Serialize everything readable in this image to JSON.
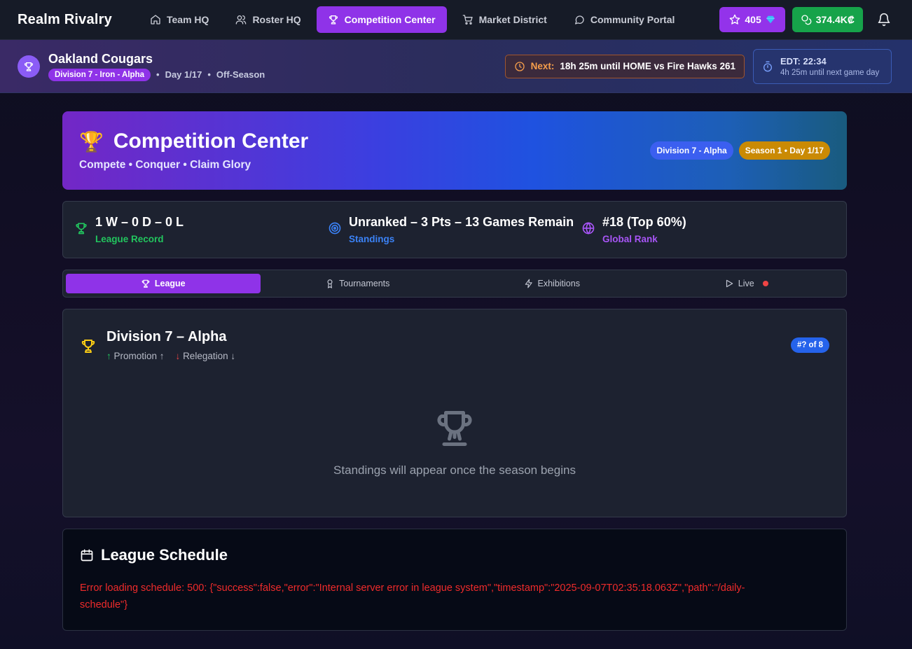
{
  "brand": "Realm Rivalry",
  "nav": {
    "items": [
      {
        "label": "Team HQ",
        "icon": "home-icon"
      },
      {
        "label": "Roster HQ",
        "icon": "users-icon"
      },
      {
        "label": "Competition Center",
        "icon": "trophy-icon"
      },
      {
        "label": "Market District",
        "icon": "cart-icon"
      },
      {
        "label": "Community Portal",
        "icon": "chat-icon"
      }
    ],
    "active_index": 2,
    "gems": "405",
    "credits": "374.4K₡"
  },
  "team": {
    "name": "Oakland Cougars",
    "division_pill": "Division 7 - Iron - Alpha",
    "day": "Day 1/17",
    "phase": "Off-Season",
    "next_label": "Next:",
    "next_text": "18h 25m until HOME vs Fire Hawks 261",
    "edt_time": "EDT: 22:34",
    "edt_sub": "4h 25m until next game day"
  },
  "hero": {
    "title": "Competition Center",
    "subtitle": "Compete • Conquer • Claim Glory",
    "badge_division": "Division 7 - Alpha",
    "badge_season": "Season 1 • Day 1/17"
  },
  "stats": [
    {
      "value": "1 W – 0 D – 0 L",
      "label": "League Record",
      "color": "#22c55e"
    },
    {
      "value": "Unranked – 3 Pts – 13 Games Remain",
      "label": "Standings",
      "color": "#3b82f6"
    },
    {
      "value": "#18 (Top 60%)",
      "label": "Global Rank",
      "color": "#a855f7"
    }
  ],
  "tabs": [
    "League",
    "Tournaments",
    "Exhibitions",
    "Live"
  ],
  "division": {
    "title": "Division 7 – Alpha",
    "promotion": "Promotion ↑",
    "relegation": "Relegation ↓",
    "rank_pill": "#? of 8",
    "empty_text": "Standings will appear once the season begins"
  },
  "schedule": {
    "title": "League Schedule",
    "error_line1": "Error loading schedule: 500: {\"success\":false,\"error\":\"Internal server error in league system\",\"timestamp\":\"2025-09-07T02:35:18.063Z\",\"path\":\"/daily-",
    "error_line2": "schedule\"}"
  }
}
